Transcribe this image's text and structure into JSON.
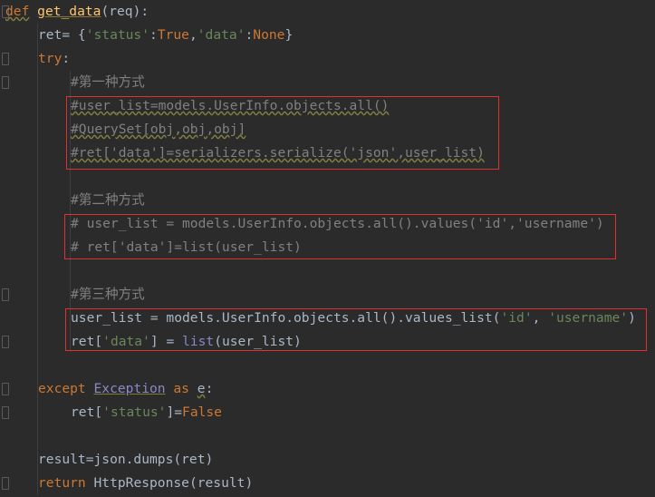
{
  "code": {
    "l1": {
      "kw": "def",
      "name": "get_data",
      "args": "(req):"
    },
    "l2": {
      "a": "ret= {",
      "s1": "'status'",
      "b": ":",
      "t": "True",
      "c": ",",
      "s2": "'data'",
      "d": ":",
      "n": "None",
      "e": "}"
    },
    "l3": {
      "kw": "try",
      "c": ":"
    },
    "l4": "#第一种方式",
    "l5": "#user_list=models.UserInfo.objects.all()",
    "l6": "#QuerySet[obj,obj,obj]",
    "l7": "#ret['data']=serializers.serialize('json',user_list)",
    "l8": "#第二种方式",
    "l9": "# user_list = models.UserInfo.objects.all().values('id','username')",
    "l10": "# ret['data']=list(user_list)",
    "l11": "#第三种方式",
    "l12": {
      "a": "user_list = models.UserInfo.objects.all().values_list(",
      "s1": "'id'",
      "b": ", ",
      "s2": "'username'",
      "c": ")"
    },
    "l13": {
      "a": "ret[",
      "s": "'data'",
      "b": "] = ",
      "f": "list",
      "c": "(user_list)"
    },
    "l14": {
      "kw": "except",
      "cls": "Exception",
      "as": "as",
      "e": "e",
      "c": ":"
    },
    "l15": {
      "a": "ret[",
      "s": "'status'",
      "b": "]=",
      "f": "False"
    },
    "l16": "result=json.dumps(ret)",
    "l17": {
      "kw": "return",
      "rest": "HttpResponse(result)"
    }
  }
}
